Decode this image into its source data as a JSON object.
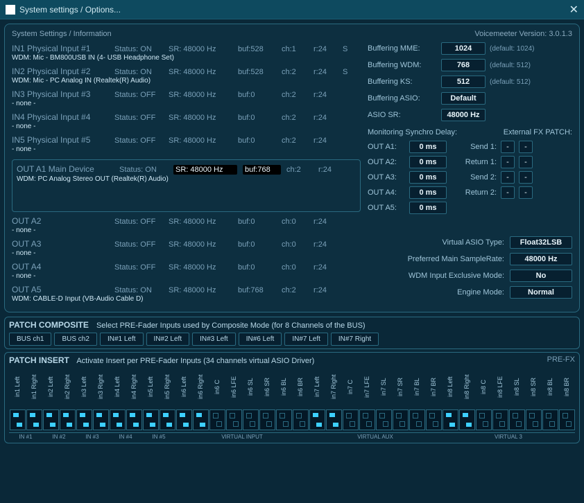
{
  "titlebar": {
    "title": "System settings / Options..."
  },
  "header": {
    "left": "System Settings / Information",
    "center": "Voicemeeter Version: 3.0.1.3"
  },
  "inputs": [
    {
      "name": "IN1 Physical Input #1",
      "status": "Status: ON",
      "sr": "SR: 48000 Hz",
      "buf": "buf:528",
      "ch": "ch:1",
      "r": "r:24",
      "s": "S",
      "sub": "WDM: Mic - BM800USB IN (4- USB Headphone Set)"
    },
    {
      "name": "IN2 Physical Input #2",
      "status": "Status: ON",
      "sr": "SR: 48000 Hz",
      "buf": "buf:528",
      "ch": "ch:2",
      "r": "r:24",
      "s": "S",
      "sub": "WDM: Mic - PC Analog IN (Realtek(R) Audio)"
    },
    {
      "name": "IN3 Physical Input #3",
      "status": "Status: OFF",
      "sr": "SR: 48000 Hz",
      "buf": "buf:0",
      "ch": "ch:2",
      "r": "r:24",
      "s": "",
      "sub": "- none -"
    },
    {
      "name": "IN4 Physical Input #4",
      "status": "Status: OFF",
      "sr": "SR: 48000 Hz",
      "buf": "buf:0",
      "ch": "ch:2",
      "r": "r:24",
      "s": "",
      "sub": "- none -"
    },
    {
      "name": "IN5 Physical Input #5",
      "status": "Status: OFF",
      "sr": "SR: 48000 Hz",
      "buf": "buf:0",
      "ch": "ch:2",
      "r": "r:24",
      "s": "",
      "sub": "- none -"
    }
  ],
  "out_a1": {
    "name": "OUT A1 Main Device",
    "status": "Status: ON",
    "sr": "SR: 48000 Hz",
    "buf": "buf:768",
    "ch": "ch:2",
    "r": "r:24",
    "sub": "WDM: PC Analog Stereo OUT (Realtek(R) Audio)"
  },
  "outputs": [
    {
      "name": "OUT A2",
      "status": "Status: OFF",
      "sr": "SR: 48000 Hz",
      "buf": "buf:0",
      "ch": "ch:0",
      "r": "r:24",
      "sub": "- none -"
    },
    {
      "name": "OUT A3",
      "status": "Status: OFF",
      "sr": "SR: 48000 Hz",
      "buf": "buf:0",
      "ch": "ch:0",
      "r": "r:24",
      "sub": "- none -"
    },
    {
      "name": "OUT A4",
      "status": "Status: OFF",
      "sr": "SR: 48000 Hz",
      "buf": "buf:0",
      "ch": "ch:0",
      "r": "r:24",
      "sub": "- none -"
    },
    {
      "name": "OUT A5",
      "status": "Status: ON",
      "sr": "SR: 48000 Hz",
      "buf": "buf:768",
      "ch": "ch:2",
      "r": "r:24",
      "sub": "WDM: CABLE-D Input (VB-Audio Cable D)"
    }
  ],
  "buffering": [
    {
      "label": "Buffering MME:",
      "value": "1024",
      "def": "(default: 1024)"
    },
    {
      "label": "Buffering WDM:",
      "value": "768",
      "def": "(default: 512)"
    },
    {
      "label": "Buffering KS:",
      "value": "512",
      "def": "(default: 512)"
    },
    {
      "label": "Buffering ASIO:",
      "value": "Default",
      "def": ""
    },
    {
      "label": "ASIO SR:",
      "value": "48000 Hz",
      "def": ""
    }
  ],
  "mon_header": {
    "left": "Monitoring Synchro Delay:",
    "right": "External FX PATCH:"
  },
  "monitoring": [
    {
      "label": "OUT A1:",
      "value": "0 ms",
      "fx_label": "Send 1:",
      "fx1": "-",
      "fx2": "-"
    },
    {
      "label": "OUT A2:",
      "value": "0 ms",
      "fx_label": "Return 1:",
      "fx1": "-",
      "fx2": "-"
    },
    {
      "label": "OUT A3:",
      "value": "0 ms",
      "fx_label": "Send 2:",
      "fx1": "-",
      "fx2": "-"
    },
    {
      "label": "OUT A4:",
      "value": "0 ms",
      "fx_label": "Return 2:",
      "fx1": "-",
      "fx2": "-"
    },
    {
      "label": "OUT A5:",
      "value": "0 ms",
      "fx_label": "",
      "fx1": "",
      "fx2": ""
    }
  ],
  "options": [
    {
      "label": "Virtual ASIO Type:",
      "value": "Float32LSB"
    },
    {
      "label": "Preferred Main SampleRate:",
      "value": "48000 Hz"
    },
    {
      "label": "WDM Input Exclusive Mode:",
      "value": "No"
    },
    {
      "label": "Engine Mode:",
      "value": "Normal"
    }
  ],
  "patch_composite": {
    "title": "PATCH COMPOSITE",
    "desc": "Select PRE-Fader Inputs used by Composite Mode (for 8 Channels of the BUS)",
    "buttons": [
      "BUS ch1",
      "BUS ch2",
      "IN#1 Left",
      "IN#2 Left",
      "IN#3 Left",
      "IN#6 Left",
      "IN#7 Left",
      "IN#7 Right"
    ]
  },
  "patch_insert": {
    "title": "PATCH INSERT",
    "desc": "Activate Insert per PRE-Fader Inputs (34 channels virtual ASIO Driver)",
    "right": "PRE-FX",
    "channels": [
      {
        "l": "in1 Left",
        "a": 1
      },
      {
        "l": "in1 Right",
        "a": 1
      },
      {
        "l": "in2 Left",
        "a": 1
      },
      {
        "l": "in2 Right",
        "a": 1
      },
      {
        "l": "in3 Left",
        "a": 1
      },
      {
        "l": "in3 Right",
        "a": 1
      },
      {
        "l": "in4 Left",
        "a": 1
      },
      {
        "l": "in4 Right",
        "a": 1
      },
      {
        "l": "in5 Left",
        "a": 1
      },
      {
        "l": "in5 Right",
        "a": 1
      },
      {
        "l": "in6 Left",
        "a": 1
      },
      {
        "l": "in6 Right",
        "a": 1
      },
      {
        "l": "in6 C",
        "a": 0
      },
      {
        "l": "in6 LFE",
        "a": 0
      },
      {
        "l": "in6 SL",
        "a": 0
      },
      {
        "l": "in6 SR",
        "a": 0
      },
      {
        "l": "in6 BL",
        "a": 0
      },
      {
        "l": "in6 BR",
        "a": 0
      },
      {
        "l": "in7 Left",
        "a": 1
      },
      {
        "l": "in7 Right",
        "a": 1
      },
      {
        "l": "in7 C",
        "a": 0
      },
      {
        "l": "in7 LFE",
        "a": 0
      },
      {
        "l": "in7 SL",
        "a": 0
      },
      {
        "l": "in7 SR",
        "a": 0
      },
      {
        "l": "in7 BL",
        "a": 0
      },
      {
        "l": "in7 BR",
        "a": 0
      },
      {
        "l": "in8 Left",
        "a": 1
      },
      {
        "l": "in8 Right",
        "a": 1
      },
      {
        "l": "in8 C",
        "a": 0
      },
      {
        "l": "in8 LFE",
        "a": 0
      },
      {
        "l": "in8 SL",
        "a": 0
      },
      {
        "l": "in8 SR",
        "a": 0
      },
      {
        "l": "in8 BL",
        "a": 0
      },
      {
        "l": "in8 BR",
        "a": 0
      }
    ],
    "groups": [
      {
        "l": "IN #1",
        "w": 2
      },
      {
        "l": "IN #2",
        "w": 2
      },
      {
        "l": "IN #3",
        "w": 2
      },
      {
        "l": "IN #4",
        "w": 2
      },
      {
        "l": "IN #5",
        "w": 2
      },
      {
        "l": "VIRTUAL INPUT",
        "w": 8
      },
      {
        "l": "VIRTUAL AUX",
        "w": 8
      },
      {
        "l": "VIRTUAL 3",
        "w": 8
      }
    ]
  }
}
